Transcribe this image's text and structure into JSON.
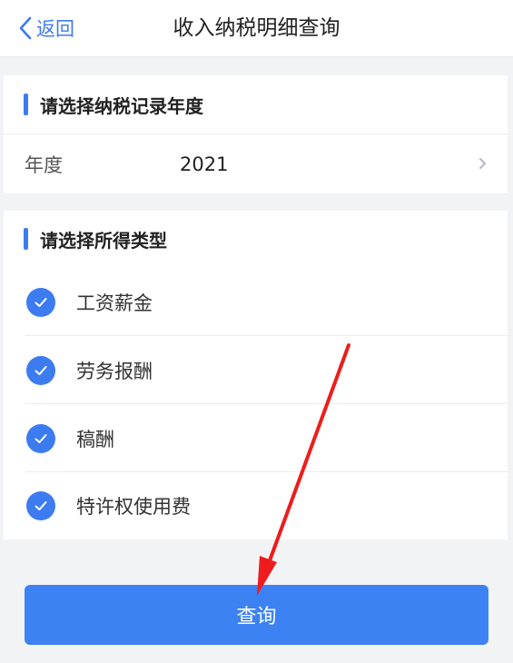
{
  "header": {
    "back_label": "返回",
    "title": "收入纳税明细查询"
  },
  "year_section": {
    "heading": "请选择纳税记录年度",
    "year_label": "年度",
    "year_value": "2021"
  },
  "type_section": {
    "heading": "请选择所得类型",
    "items": [
      {
        "label": "工资薪金",
        "checked": true
      },
      {
        "label": "劳务报酬",
        "checked": true
      },
      {
        "label": "稿酬",
        "checked": true
      },
      {
        "label": "特许权使用费",
        "checked": true
      }
    ]
  },
  "query_button": {
    "label": "查询"
  },
  "colors": {
    "accent": "#3d7bf0",
    "button": "#3d82f3",
    "annotation_arrow": "#ee1c1c",
    "background": "#f2f3f5"
  },
  "icons": {
    "back": "chevron-left-icon",
    "year_picker": "chevron-right-icon",
    "checked": "check-circle-icon"
  }
}
